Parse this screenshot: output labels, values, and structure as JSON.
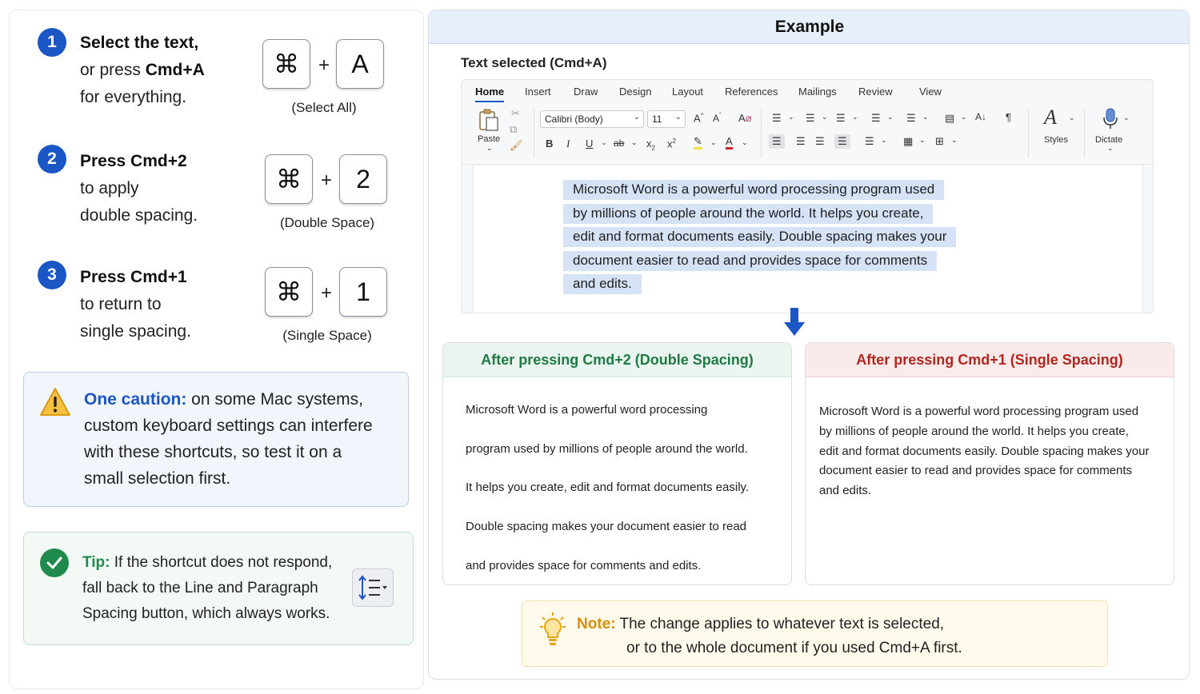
{
  "steps": [
    {
      "number": "1",
      "line1": "Select the text,",
      "line2_pre": "or press ",
      "line2_bold": "Cmd+A",
      "line3": "for everything.",
      "key_cmd": "⌘",
      "plus": "+",
      "key": "A",
      "caption": "(Select All)"
    },
    {
      "number": "2",
      "line1": "Press Cmd+2",
      "line2": "to apply",
      "line3": "double spacing.",
      "key_cmd": "⌘",
      "plus": "+",
      "key": "2",
      "caption": "(Double Space)"
    },
    {
      "number": "3",
      "line1": "Press Cmd+1",
      "line2": "to return to",
      "line3": "single spacing.",
      "key_cmd": "⌘",
      "plus": "+",
      "key": "1",
      "caption": "(Single Space)"
    }
  ],
  "caution": {
    "icon": "warning-icon",
    "label": "One caution:",
    "line1": " on some Mac systems,",
    "line2": "custom keyboard settings can interfere",
    "line3": "with these shortcuts, so test it on a",
    "line4": "small selection first."
  },
  "tip": {
    "icon": "check-circle-icon",
    "label": "Tip:",
    "line1": "  If the shortcut does not respond,",
    "line2": "fall back to the Line and Paragraph",
    "line3": "Spacing button, which always works.",
    "button_icon": "line-spacing-icon"
  },
  "example": {
    "title": "Example",
    "selected_label": "Text selected (Cmd+A)",
    "ribbon_tabs": [
      "Home",
      "Insert",
      "Draw",
      "Design",
      "Layout",
      "References",
      "Mailings",
      "Review",
      "View"
    ],
    "paste_label": "Paste",
    "font_name": "Calibri (Body)",
    "font_size": "11",
    "styles_label": "Styles",
    "dictate_label": "Dictate",
    "doc_lines": [
      "Microsoft Word is a powerful word processing program used",
      "by millions of people around the world. It helps you create,",
      "edit and format documents easily. Double spacing makes your",
      "document easier to read and provides space for comments",
      "and edits."
    ]
  },
  "after_double": {
    "title": "After pressing Cmd+2 (Double Spacing)",
    "lines": [
      "Microsoft Word is a powerful word processing",
      "program used by millions of people around the world.",
      "It helps you create, edit and format documents easily.",
      "Double spacing makes your document easier to read",
      "and provides space for comments and edits."
    ]
  },
  "after_single": {
    "title": "After pressing Cmd+1 (Single Spacing)",
    "lines": [
      "Microsoft Word is a powerful word processing program used",
      "by millions of people around the world. It helps you create,",
      "edit and format documents easily. Double spacing makes your",
      "document easier to read and provides space for comments",
      "and edits."
    ]
  },
  "note": {
    "icon": "lightbulb-icon",
    "label": "Note:",
    "line1": " The change applies to whatever text is selected,",
    "line2": "or to the whole document if you used Cmd+A first."
  },
  "colors": {
    "accent_blue": "#1a56c4",
    "success_green": "#1e8a4c",
    "danger_red": "#b3261e",
    "note_amber": "#d98e0b",
    "selection": "#d6e2f6"
  }
}
